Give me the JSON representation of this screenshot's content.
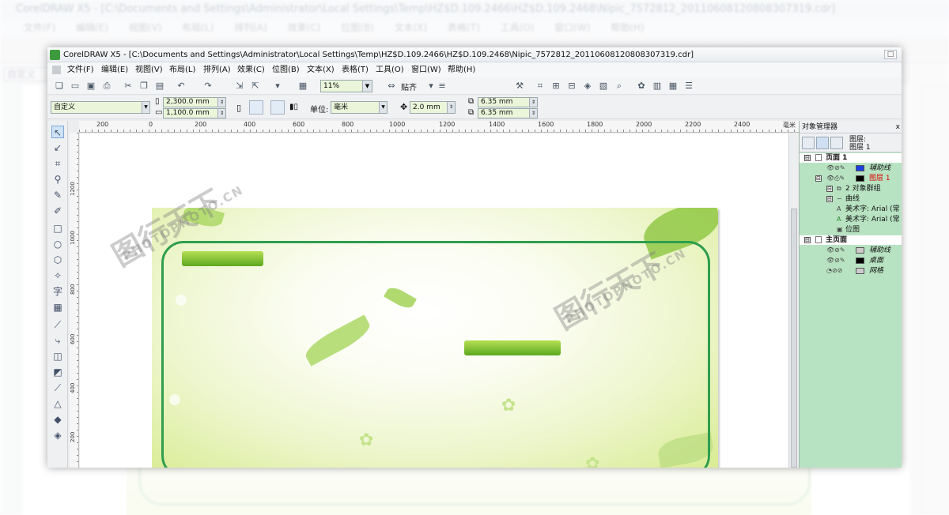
{
  "background_window": {
    "title": "CorelDRAW X5 - [C:\\Documents and Settings\\Administrator\\Local Settings\\Temp\\HZ$D.109.2466\\HZ$D.109.2468\\Nipic_7572812_20110608120808307319.cdr]",
    "menu": [
      "文件(F)",
      "编辑(E)",
      "视图(V)",
      "布局(L)",
      "排列(A)",
      "效果(C)",
      "位图(B)",
      "文本(X)",
      "表格(T)",
      "工具(O)",
      "窗口(W)",
      "帮助(H)"
    ],
    "preset": "自定义"
  },
  "window": {
    "title": "CorelDRAW X5 - [C:\\Documents and Settings\\Administrator\\Local Settings\\Temp\\HZ$D.109.2466\\HZ$D.109.2468\\Nipic_7572812_20110608120808307319.cdr]",
    "restore_btn": "□"
  },
  "menu": [
    "文件(F)",
    "编辑(E)",
    "视图(V)",
    "布局(L)",
    "排列(A)",
    "效果(C)",
    "位图(B)",
    "文本(X)",
    "表格(T)",
    "工具(O)",
    "窗口(W)",
    "帮助(H)"
  ],
  "toolbar": {
    "zoom": "11%",
    "snap_label": "贴齐"
  },
  "propbar": {
    "preset": "自定义",
    "width": "2,300.0 mm",
    "height": "1,100.0 mm",
    "units_label": "单位:",
    "units_value": "毫米",
    "nudge": "2.0 mm",
    "dup_x": "6.35 mm",
    "dup_y": "6.35 mm"
  },
  "ruler": {
    "h_ticks": [
      "200",
      "0",
      "200",
      "400",
      "600",
      "800",
      "1000",
      "1200",
      "1400",
      "1600",
      "1800",
      "2000",
      "2200",
      "2400",
      "毫米"
    ],
    "v_ticks": [
      "1200",
      "1000",
      "800",
      "600",
      "400",
      "200"
    ]
  },
  "tools": [
    "pick-tool",
    "shape-tool",
    "crop-tool",
    "zoom-tool",
    "freehand-tool",
    "smart-fill-tool",
    "rectangle-tool",
    "ellipse-tool",
    "polygon-tool",
    "basic-shapes-tool",
    "text-tool",
    "table-tool",
    "dimension-tool",
    "connector-tool",
    "blend-tool",
    "transparency-tool",
    "eyedropper-tool",
    "outline-tool",
    "fill-tool",
    "interactive-fill-tool"
  ],
  "text_tool_glyph": "字",
  "object_manager": {
    "title": "对象管理器",
    "close": "x",
    "layer_label_1": "图层:",
    "layer_label_2": "图层 1",
    "rows": {
      "page1": "页面 1",
      "guides1": "辅助线",
      "layer1": "图层 1",
      "group": "2 对象群组",
      "curve": "曲线",
      "text1": "美术字: Arial (常",
      "text2": "美术字: Arial (常",
      "bitmap": "位图",
      "master": "主页面",
      "guides2": "辅助线",
      "desktop": "桌面",
      "grid": "网格"
    },
    "expand": "⊟"
  },
  "watermarks": [
    "图行天下",
    "PHOTOPHOTO.CN"
  ],
  "colors": {
    "frame": "#2f9e4f",
    "bar": "#5ca81f",
    "panel": "#b8e3c2",
    "swatch_blue": "#1a3fe0",
    "swatch_black": "#000000",
    "swatch_gray": "#cccccc"
  }
}
